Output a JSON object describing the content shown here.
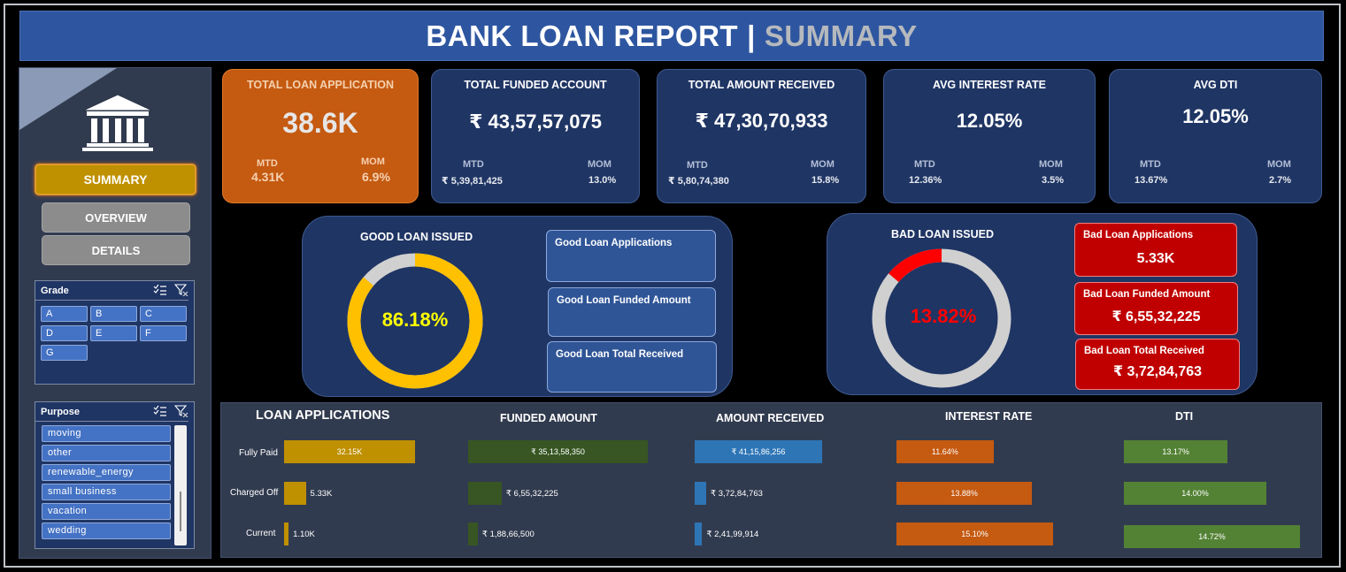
{
  "header": {
    "title": "BANK LOAN REPORT",
    "separator": "|",
    "subtitle": "SUMMARY"
  },
  "sidebar": {
    "nav": [
      {
        "label": "SUMMARY",
        "active": true
      },
      {
        "label": "OVERVIEW",
        "active": false
      },
      {
        "label": "DETAILS",
        "active": false
      }
    ],
    "grade_slicer": {
      "title": "Grade",
      "items": [
        "A",
        "B",
        "C",
        "D",
        "E",
        "F",
        "G"
      ]
    },
    "purpose_slicer": {
      "title": "Purpose",
      "items": [
        "moving",
        "other",
        "renewable_energy",
        "small business",
        "vacation",
        "wedding"
      ]
    }
  },
  "kpis": [
    {
      "title": "TOTAL LOAN APPLICATION",
      "value": "38.6K",
      "mtd_label": "MTD",
      "mtd": "4.31K",
      "mom_label": "MOM",
      "mom": "6.9%"
    },
    {
      "title": "TOTAL FUNDED ACCOUNT",
      "value": "₹ 43,57,57,075",
      "mtd_label": "MTD",
      "mtd": "₹ 5,39,81,425",
      "mom_label": "MOM",
      "mom": "13.0%"
    },
    {
      "title": "TOTAL AMOUNT RECEIVED",
      "value": "₹ 47,30,70,933",
      "mtd_label": "MTD",
      "mtd": "₹ 5,80,74,380",
      "mom_label": "MOM",
      "mom": "15.8%"
    },
    {
      "title": "AVG INTEREST RATE",
      "value": "12.05%",
      "mtd_label": "MTD",
      "mtd": "12.36%",
      "mom_label": "MOM",
      "mom": "3.5%"
    },
    {
      "title": "AVG DTI",
      "value": "12.05%",
      "mtd_label": "MTD",
      "mtd": "13.67%",
      "mom_label": "MOM",
      "mom": "2.7%"
    }
  ],
  "good_loan": {
    "title": "GOOD LOAN ISSUED",
    "percent_label": "86.18%",
    "percent": 86.18,
    "color": "#ffc000",
    "track_color": "#d0d0d0",
    "boxes": [
      "Good Loan Applications",
      "Good Loan Funded Amount",
      "Good Loan Total Received"
    ]
  },
  "bad_loan": {
    "title": "BAD LOAN ISSUED",
    "percent_label": "13.82%",
    "percent": 13.82,
    "color": "#ff0000",
    "track_color": "#d0d0d0",
    "boxes": [
      {
        "label": "Bad Loan Applications",
        "value": "5.33K"
      },
      {
        "label": "Bad Loan Funded Amount",
        "value": "₹ 6,55,32,225"
      },
      {
        "label": "Bad Loan Total Received",
        "value": "₹ 3,72,84,763"
      }
    ]
  },
  "chart_data": [
    {
      "type": "bar",
      "title": "LOAN APPLICATIONS",
      "categories": [
        "Fully Paid",
        "Charged Off",
        "Current"
      ],
      "values": [
        32.15,
        5.33,
        1.1
      ],
      "labels": [
        "32.15K",
        "5.33K",
        "1.10K"
      ],
      "color": "#bf9000"
    },
    {
      "type": "bar",
      "title": "FUNDED AMOUNT",
      "categories": [
        "Fully Paid",
        "Charged Off",
        "Current"
      ],
      "values": [
        351358350,
        65532225,
        18866500
      ],
      "labels": [
        "₹ 35,13,58,350",
        "₹ 6,55,32,225",
        "₹ 1,88,66,500"
      ],
      "color": "#375623"
    },
    {
      "type": "bar",
      "title": "AMOUNT RECEIVED",
      "categories": [
        "Fully Paid",
        "Charged Off",
        "Current"
      ],
      "values": [
        411586256,
        37284763,
        24199914
      ],
      "labels": [
        "₹ 41,15,86,256",
        "₹ 3,72,84,763",
        "₹ 2,41,99,914"
      ],
      "color": "#2e75b6"
    },
    {
      "type": "bar",
      "title": "INTEREST RATE",
      "categories": [
        "Fully Paid",
        "Charged Off",
        "Current"
      ],
      "values": [
        11.64,
        13.88,
        15.1
      ],
      "labels": [
        "11.64%",
        "13.88%",
        "15.10%"
      ],
      "color": "#c55a11"
    },
    {
      "type": "bar",
      "title": "DTI",
      "categories": [
        "Fully Paid",
        "Charged Off",
        "Current"
      ],
      "values": [
        13.17,
        14.0,
        14.72
      ],
      "labels": [
        "13.17%",
        "14.00%",
        "14.72%"
      ],
      "color": "#548235"
    }
  ]
}
